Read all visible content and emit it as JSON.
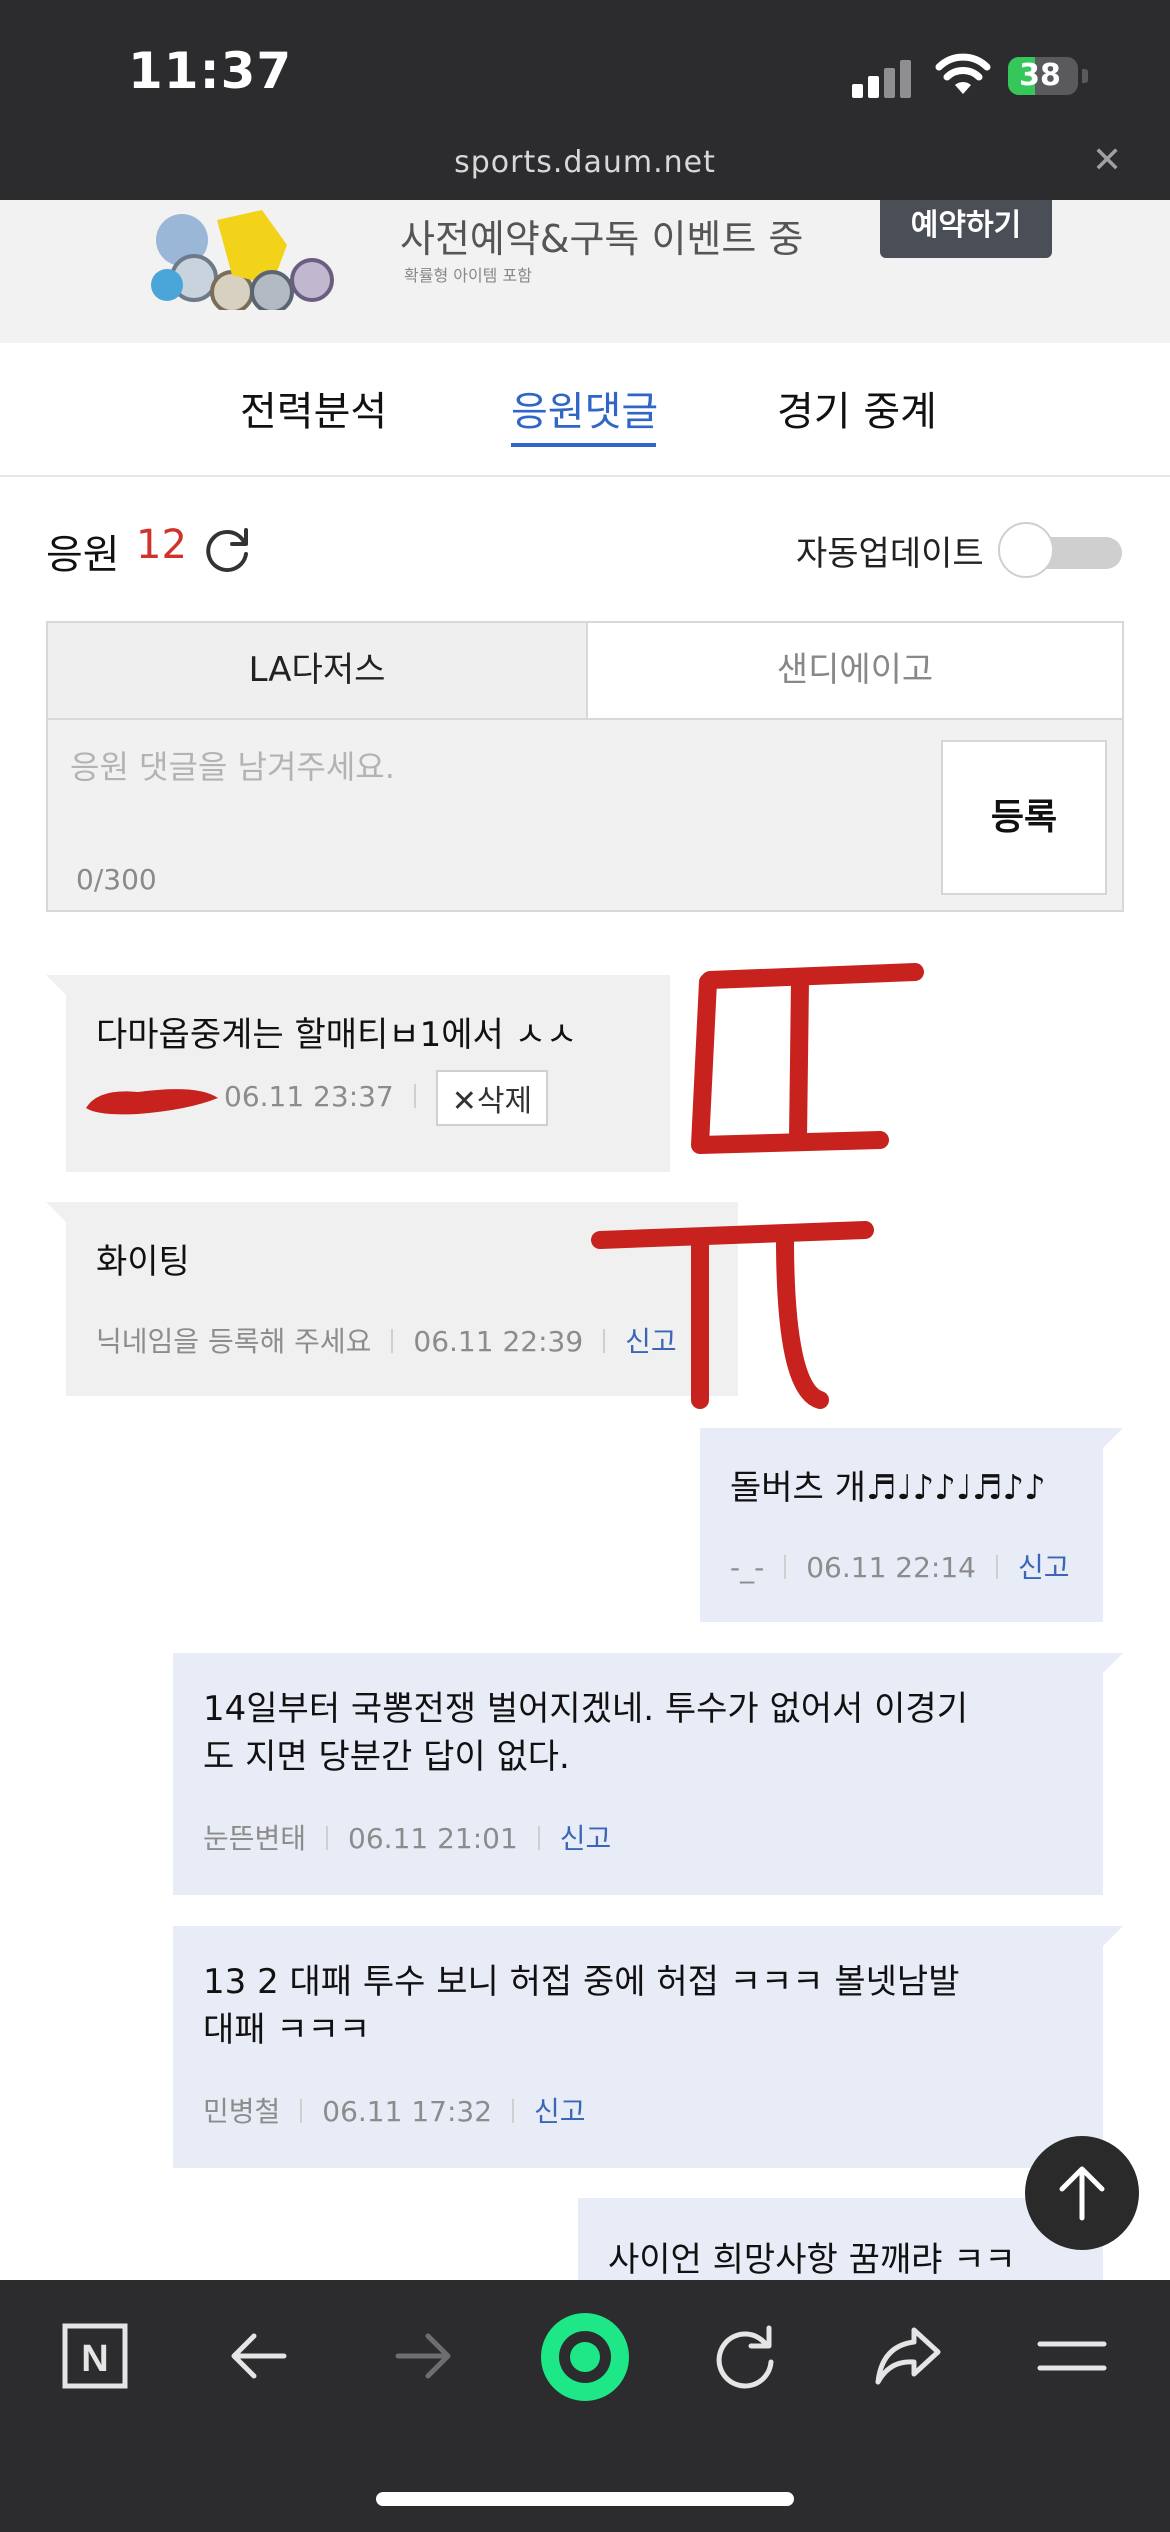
{
  "status_bar": {
    "time": "11:37",
    "battery": "38",
    "battery_level": 0.38,
    "url": "sports.daum.net"
  },
  "ad": {
    "title": "사전예약&구독 이벤트 중",
    "subtitle": "확률형 아이템 포함",
    "button": "예약하기"
  },
  "tabs": [
    {
      "label": "전력분석",
      "active": false
    },
    {
      "label": "응원댓글",
      "active": true
    },
    {
      "label": "경기 중계",
      "active": false
    }
  ],
  "cheer": {
    "label": "응원",
    "count": "12",
    "auto_update_label": "자동업데이트",
    "auto_update_on": false
  },
  "form": {
    "team_a": "LA다저스",
    "team_b": "샌디에이고",
    "placeholder": "응원 댓글을 남겨주세요.",
    "char_count": "0/300",
    "submit": "등록"
  },
  "comments": [
    {
      "text": "다마옵중계는 할매티ㅂ1에서 ㅅㅅ",
      "author": "",
      "time": "06.11 23:37",
      "action": "삭제",
      "side": "left"
    },
    {
      "text": "화이팅",
      "author": "닉네임을 등록해 주세요",
      "time": "06.11 22:39",
      "action": "신고",
      "side": "left"
    },
    {
      "text": "돌버츠 개♬♩♪♪♩♬♪♪",
      "author": "-_-",
      "time": "06.11 22:14",
      "action": "신고",
      "side": "right"
    },
    {
      "text": "14일부터 국뽕전쟁 벌어지겠네. 투수가 없어서 이경기도 지면 당분간 답이 없다.",
      "line1": "14일부터 국뽕전쟁 벌어지겠네. 투수가 없어서 이경기",
      "line2": "도 지면 당분간 답이 없다.",
      "author": "눈뜬변태",
      "time": "06.11 21:01",
      "action": "신고",
      "side": "right"
    },
    {
      "text": "13 2 대패 투수 보니 허접 중에 허접 ㅋㅋㅋ 볼넷남발 대패 ㅋㅋㅋ",
      "line1": "13 2 대패 투수 보니 허접 중에 허접 ㅋㅋㅋ 볼넷남발",
      "line2": "대패 ㅋㅋㅋ",
      "author": "민병철",
      "time": "06.11 17:32",
      "action": "신고",
      "side": "right"
    },
    {
      "text": "사이언 희망사항 꿈깨랴 ㅋㅋ",
      "side": "right"
    }
  ],
  "icons": {
    "refresh": "refresh-icon",
    "scroll_top": "arrow-up-icon",
    "naver": "naver-n-icon",
    "back": "back-arrow-icon",
    "forward": "forward-arrow-icon",
    "home": "green-home-icon",
    "reload": "reload-icon",
    "share": "share-icon",
    "menu": "menu-icon"
  },
  "bottom_bar": {
    "naver_letter": "N"
  },
  "colors": {
    "accent": "#2f66c7",
    "count_red": "#d0332c",
    "report_blue": "#3b66b7",
    "home_green": "#1ee787",
    "annotation_red": "#c8221e"
  }
}
